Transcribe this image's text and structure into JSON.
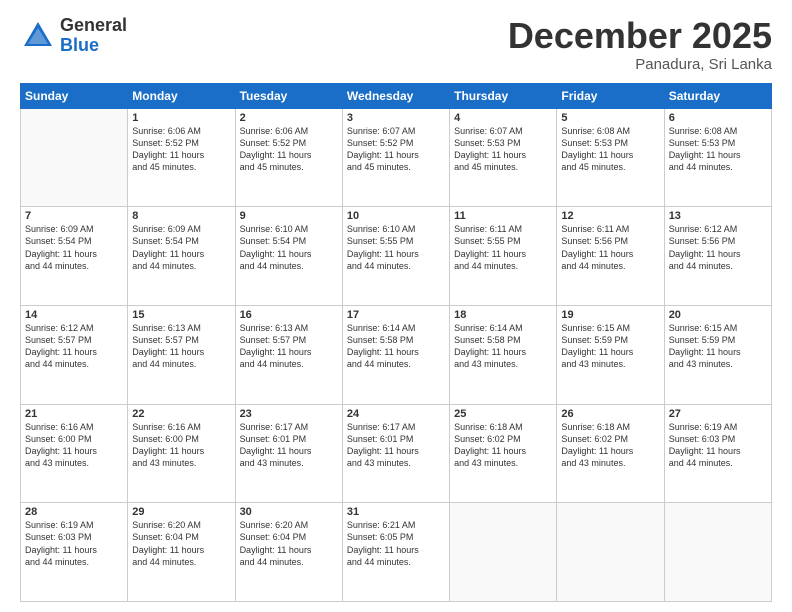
{
  "header": {
    "logo_general": "General",
    "logo_blue": "Blue",
    "month": "December 2025",
    "location": "Panadura, Sri Lanka"
  },
  "days_of_week": [
    "Sunday",
    "Monday",
    "Tuesday",
    "Wednesday",
    "Thursday",
    "Friday",
    "Saturday"
  ],
  "weeks": [
    [
      {
        "day": "",
        "info": ""
      },
      {
        "day": "1",
        "info": "Sunrise: 6:06 AM\nSunset: 5:52 PM\nDaylight: 11 hours\nand 45 minutes."
      },
      {
        "day": "2",
        "info": "Sunrise: 6:06 AM\nSunset: 5:52 PM\nDaylight: 11 hours\nand 45 minutes."
      },
      {
        "day": "3",
        "info": "Sunrise: 6:07 AM\nSunset: 5:52 PM\nDaylight: 11 hours\nand 45 minutes."
      },
      {
        "day": "4",
        "info": "Sunrise: 6:07 AM\nSunset: 5:53 PM\nDaylight: 11 hours\nand 45 minutes."
      },
      {
        "day": "5",
        "info": "Sunrise: 6:08 AM\nSunset: 5:53 PM\nDaylight: 11 hours\nand 45 minutes."
      },
      {
        "day": "6",
        "info": "Sunrise: 6:08 AM\nSunset: 5:53 PM\nDaylight: 11 hours\nand 44 minutes."
      }
    ],
    [
      {
        "day": "7",
        "info": "Sunrise: 6:09 AM\nSunset: 5:54 PM\nDaylight: 11 hours\nand 44 minutes."
      },
      {
        "day": "8",
        "info": "Sunrise: 6:09 AM\nSunset: 5:54 PM\nDaylight: 11 hours\nand 44 minutes."
      },
      {
        "day": "9",
        "info": "Sunrise: 6:10 AM\nSunset: 5:54 PM\nDaylight: 11 hours\nand 44 minutes."
      },
      {
        "day": "10",
        "info": "Sunrise: 6:10 AM\nSunset: 5:55 PM\nDaylight: 11 hours\nand 44 minutes."
      },
      {
        "day": "11",
        "info": "Sunrise: 6:11 AM\nSunset: 5:55 PM\nDaylight: 11 hours\nand 44 minutes."
      },
      {
        "day": "12",
        "info": "Sunrise: 6:11 AM\nSunset: 5:56 PM\nDaylight: 11 hours\nand 44 minutes."
      },
      {
        "day": "13",
        "info": "Sunrise: 6:12 AM\nSunset: 5:56 PM\nDaylight: 11 hours\nand 44 minutes."
      }
    ],
    [
      {
        "day": "14",
        "info": "Sunrise: 6:12 AM\nSunset: 5:57 PM\nDaylight: 11 hours\nand 44 minutes."
      },
      {
        "day": "15",
        "info": "Sunrise: 6:13 AM\nSunset: 5:57 PM\nDaylight: 11 hours\nand 44 minutes."
      },
      {
        "day": "16",
        "info": "Sunrise: 6:13 AM\nSunset: 5:57 PM\nDaylight: 11 hours\nand 44 minutes."
      },
      {
        "day": "17",
        "info": "Sunrise: 6:14 AM\nSunset: 5:58 PM\nDaylight: 11 hours\nand 44 minutes."
      },
      {
        "day": "18",
        "info": "Sunrise: 6:14 AM\nSunset: 5:58 PM\nDaylight: 11 hours\nand 43 minutes."
      },
      {
        "day": "19",
        "info": "Sunrise: 6:15 AM\nSunset: 5:59 PM\nDaylight: 11 hours\nand 43 minutes."
      },
      {
        "day": "20",
        "info": "Sunrise: 6:15 AM\nSunset: 5:59 PM\nDaylight: 11 hours\nand 43 minutes."
      }
    ],
    [
      {
        "day": "21",
        "info": "Sunrise: 6:16 AM\nSunset: 6:00 PM\nDaylight: 11 hours\nand 43 minutes."
      },
      {
        "day": "22",
        "info": "Sunrise: 6:16 AM\nSunset: 6:00 PM\nDaylight: 11 hours\nand 43 minutes."
      },
      {
        "day": "23",
        "info": "Sunrise: 6:17 AM\nSunset: 6:01 PM\nDaylight: 11 hours\nand 43 minutes."
      },
      {
        "day": "24",
        "info": "Sunrise: 6:17 AM\nSunset: 6:01 PM\nDaylight: 11 hours\nand 43 minutes."
      },
      {
        "day": "25",
        "info": "Sunrise: 6:18 AM\nSunset: 6:02 PM\nDaylight: 11 hours\nand 43 minutes."
      },
      {
        "day": "26",
        "info": "Sunrise: 6:18 AM\nSunset: 6:02 PM\nDaylight: 11 hours\nand 43 minutes."
      },
      {
        "day": "27",
        "info": "Sunrise: 6:19 AM\nSunset: 6:03 PM\nDaylight: 11 hours\nand 44 minutes."
      }
    ],
    [
      {
        "day": "28",
        "info": "Sunrise: 6:19 AM\nSunset: 6:03 PM\nDaylight: 11 hours\nand 44 minutes."
      },
      {
        "day": "29",
        "info": "Sunrise: 6:20 AM\nSunset: 6:04 PM\nDaylight: 11 hours\nand 44 minutes."
      },
      {
        "day": "30",
        "info": "Sunrise: 6:20 AM\nSunset: 6:04 PM\nDaylight: 11 hours\nand 44 minutes."
      },
      {
        "day": "31",
        "info": "Sunrise: 6:21 AM\nSunset: 6:05 PM\nDaylight: 11 hours\nand 44 minutes."
      },
      {
        "day": "",
        "info": ""
      },
      {
        "day": "",
        "info": ""
      },
      {
        "day": "",
        "info": ""
      }
    ]
  ]
}
